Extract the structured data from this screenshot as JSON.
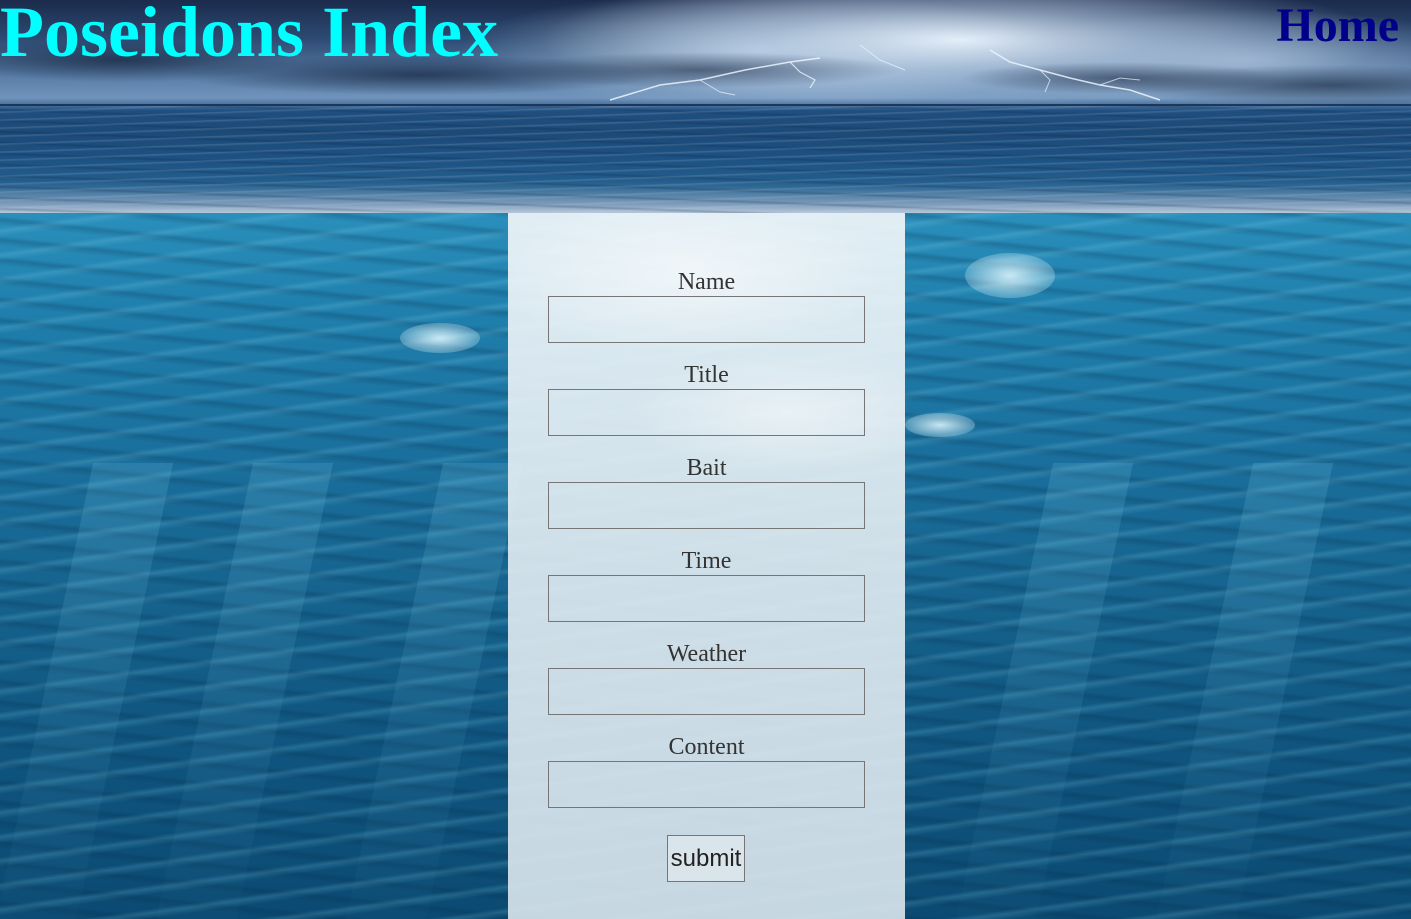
{
  "header": {
    "site_title": "Poseidons Index",
    "home_link": "Home"
  },
  "form": {
    "fields": [
      {
        "label": "Name",
        "value": "",
        "placeholder": ""
      },
      {
        "label": "Title",
        "value": "",
        "placeholder": ""
      },
      {
        "label": "Bait",
        "value": "",
        "placeholder": ""
      },
      {
        "label": "Time",
        "value": "",
        "placeholder": ""
      },
      {
        "label": "Weather",
        "value": "",
        "placeholder": ""
      },
      {
        "label": "Content",
        "value": "",
        "placeholder": ""
      }
    ],
    "submit_label": "submit"
  },
  "colors": {
    "site_title": "#00ffff",
    "home_link": "#00008b",
    "label_text": "#333333",
    "panel_background": "#e2ecf2"
  }
}
